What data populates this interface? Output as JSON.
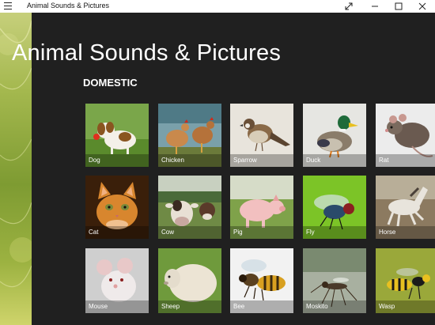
{
  "window": {
    "title": "Animal Sounds & Pictures"
  },
  "page": {
    "title": "Animal Sounds & Pictures",
    "section": "DOMESTIC"
  },
  "tiles": [
    {
      "label": "Dog",
      "bg": "#5a8a2c",
      "animal": "dog-icon"
    },
    {
      "label": "Chicken",
      "bg": "#7aa0aa",
      "animal": "chicken-icon"
    },
    {
      "label": "Sparrow",
      "bg": "#e8e4dc",
      "animal": "sparrow-icon"
    },
    {
      "label": "Duck",
      "bg": "#e6e6e2",
      "animal": "duck-icon"
    },
    {
      "label": "Rat",
      "bg": "#ececec",
      "animal": "rat-icon"
    },
    {
      "label": "Cat",
      "bg": "#3a1f0a",
      "animal": "cat-icon"
    },
    {
      "label": "Cow",
      "bg": "#6f8a45",
      "animal": "cow-icon"
    },
    {
      "label": "Pig",
      "bg": "#7fa24a",
      "animal": "pig-icon"
    },
    {
      "label": "Fly",
      "bg": "#7cc427",
      "animal": "fly-icon"
    },
    {
      "label": "Horse",
      "bg": "#8c7a60",
      "animal": "horse-icon"
    },
    {
      "label": "Mouse",
      "bg": "#cfcfcf",
      "animal": "mouse-icon"
    },
    {
      "label": "Sheep",
      "bg": "#6f9a3c",
      "animal": "sheep-icon"
    },
    {
      "label": "Bee",
      "bg": "#f2f2f2",
      "animal": "bee-icon"
    },
    {
      "label": "Moskito",
      "bg": "#a8b0a0",
      "animal": "mosquito-icon"
    },
    {
      "label": "Wasp",
      "bg": "#9aa83a",
      "animal": "wasp-icon"
    }
  ]
}
